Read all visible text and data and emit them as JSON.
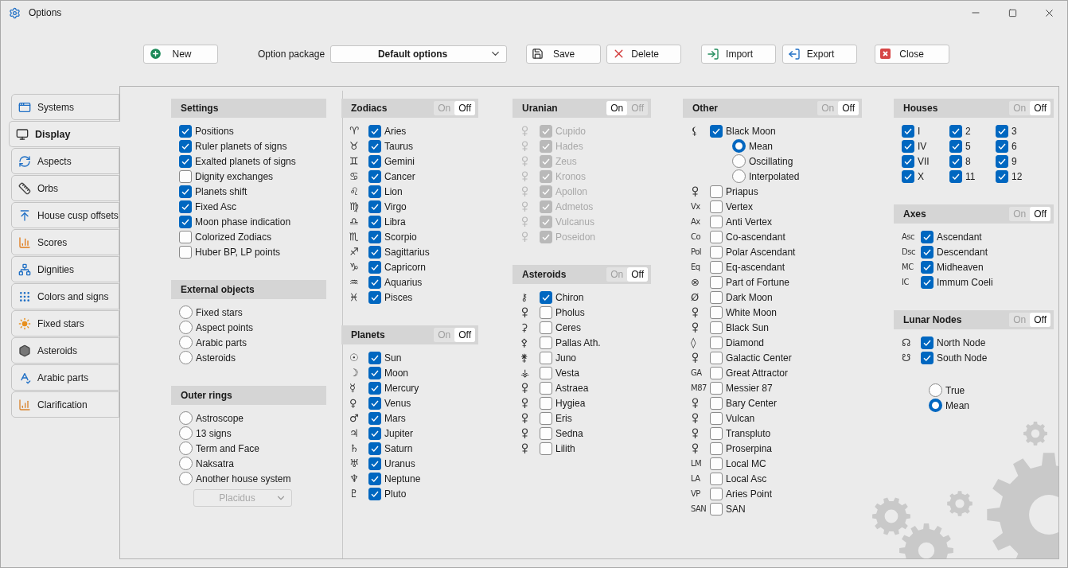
{
  "window": {
    "title": "Options"
  },
  "toolbar": [
    {
      "kind": "button",
      "label": "New"
    },
    {
      "kind": "select",
      "label": "Option package",
      "value": "Default options"
    },
    {
      "kind": "button",
      "label": "Save"
    },
    {
      "kind": "button",
      "label": "Delete"
    },
    {
      "kind": "button",
      "label": "Import"
    },
    {
      "kind": "button",
      "label": "Export"
    },
    {
      "kind": "button",
      "label": "Close"
    }
  ],
  "tabs": [
    {
      "label": "Systems",
      "selected": false
    },
    {
      "label": "Display",
      "selected": true
    },
    {
      "label": "Aspects",
      "selected": false
    },
    {
      "label": "Orbs",
      "selected": false
    },
    {
      "label": "House cusp offsets",
      "selected": false
    },
    {
      "label": "Scores",
      "selected": false
    },
    {
      "label": "Dignities",
      "selected": false
    },
    {
      "label": "Colors and signs",
      "selected": false
    },
    {
      "label": "Fixed stars",
      "selected": false
    },
    {
      "label": "Asteroids",
      "selected": false
    },
    {
      "label": "Arabic parts",
      "selected": false
    },
    {
      "label": "Clarification",
      "selected": false
    }
  ],
  "columns": [
    {
      "sections": [
        {
          "title": "Settings",
          "kind": "plain",
          "items": [
            {
              "kind": "check",
              "label": "Positions",
              "checked": true
            },
            {
              "kind": "check",
              "label": "Ruler planets of signs",
              "checked": true
            },
            {
              "kind": "check",
              "label": "Exalted planets of signs",
              "checked": true
            },
            {
              "kind": "check",
              "label": "Dignity exchanges",
              "checked": false
            },
            {
              "kind": "check",
              "label": "Planets shift",
              "checked": true
            },
            {
              "kind": "check",
              "label": "Fixed Asc",
              "checked": true
            },
            {
              "kind": "check",
              "label": "Moon phase indication",
              "checked": true
            },
            {
              "kind": "check",
              "label": "Colorized Zodiacs",
              "checked": false
            },
            {
              "kind": "check",
              "label": "Huber BP, LP points",
              "checked": false
            }
          ]
        },
        {
          "title": "External objects",
          "kind": "plain",
          "items": [
            {
              "kind": "radio",
              "label": "Fixed stars",
              "selected": false
            },
            {
              "kind": "radio",
              "label": "Aspect points",
              "selected": false
            },
            {
              "kind": "radio",
              "label": "Arabic parts",
              "selected": false
            },
            {
              "kind": "radio",
              "label": "Asteroids",
              "selected": false
            }
          ]
        },
        {
          "title": "Outer rings",
          "kind": "plain",
          "items": [
            {
              "kind": "radio",
              "label": "Astroscope",
              "selected": false
            },
            {
              "kind": "radio",
              "label": "13 signs",
              "selected": false
            },
            {
              "kind": "radio",
              "label": "Term and Face",
              "selected": false
            },
            {
              "kind": "radio",
              "label": "Naksatra",
              "selected": false
            },
            {
              "kind": "radio",
              "label": "Another house system",
              "selected": false
            },
            {
              "kind": "select",
              "value": "Placidus",
              "disabled": true
            }
          ]
        }
      ]
    },
    {
      "sections": [
        {
          "title": "Zodiacs",
          "kind": "symbols",
          "toggle": [
            {
              "label": "On",
              "selected": false
            },
            {
              "label": "Off",
              "selected": true
            }
          ],
          "items": [
            {
              "kind": "check",
              "symbol": "♈",
              "label": "Aries",
              "checked": true
            },
            {
              "kind": "check",
              "symbol": "♉",
              "label": "Taurus",
              "checked": true
            },
            {
              "kind": "check",
              "symbol": "♊",
              "label": "Gemini",
              "checked": true
            },
            {
              "kind": "check",
              "symbol": "♋",
              "label": "Cancer",
              "checked": true
            },
            {
              "kind": "check",
              "symbol": "♌",
              "label": "Lion",
              "checked": true
            },
            {
              "kind": "check",
              "symbol": "♍",
              "label": "Virgo",
              "checked": true
            },
            {
              "kind": "check",
              "symbol": "♎",
              "label": "Libra",
              "checked": true
            },
            {
              "kind": "check",
              "symbol": "♏",
              "label": "Scorpio",
              "checked": true
            },
            {
              "kind": "check",
              "symbol": "♐",
              "label": "Sagittarius",
              "checked": true
            },
            {
              "kind": "check",
              "symbol": "♑",
              "label": "Capricorn",
              "checked": true
            },
            {
              "kind": "check",
              "symbol": "♒",
              "label": "Aquarius",
              "checked": true
            },
            {
              "kind": "check",
              "symbol": "♓",
              "label": "Pisces",
              "checked": true
            }
          ]
        },
        {
          "title": "Planets",
          "kind": "symbols",
          "toggle": [
            {
              "label": "On",
              "selected": false
            },
            {
              "label": "Off",
              "selected": true
            }
          ],
          "items": [
            {
              "kind": "check",
              "symbol": "☉",
              "label": "Sun",
              "checked": true
            },
            {
              "kind": "check",
              "symbol": "☽",
              "label": "Moon",
              "checked": true
            },
            {
              "kind": "check",
              "symbol": "☿",
              "label": "Mercury",
              "checked": true
            },
            {
              "kind": "check",
              "symbol": "♀",
              "label": "Venus",
              "checked": true
            },
            {
              "kind": "check",
              "symbol": "♂",
              "label": "Mars",
              "checked": true
            },
            {
              "kind": "check",
              "symbol": "♃",
              "label": "Jupiter",
              "checked": true
            },
            {
              "kind": "check",
              "symbol": "♄",
              "label": "Saturn",
              "checked": true
            },
            {
              "kind": "check",
              "symbol": "♅",
              "label": "Uranus",
              "checked": true
            },
            {
              "kind": "check",
              "symbol": "♆",
              "label": "Neptune",
              "checked": true
            },
            {
              "kind": "check",
              "symbol": "♇",
              "label": "Pluto",
              "checked": true
            }
          ]
        }
      ]
    },
    {
      "sections": [
        {
          "title": "Uranian",
          "kind": "symbols",
          "disabled": true,
          "toggle": [
            {
              "label": "On",
              "selected": true
            },
            {
              "label": "Off",
              "selected": false
            }
          ],
          "items": [
            {
              "kind": "check",
              "label": "Cupido",
              "checked": true
            },
            {
              "kind": "check",
              "label": "Hades",
              "checked": true
            },
            {
              "kind": "check",
              "label": "Zeus",
              "checked": true
            },
            {
              "kind": "check",
              "label": "Kronos",
              "checked": true
            },
            {
              "kind": "check",
              "label": "Apollon",
              "checked": true
            },
            {
              "kind": "check",
              "label": "Admetos",
              "checked": true
            },
            {
              "kind": "check",
              "label": "Vulcanus",
              "checked": true
            },
            {
              "kind": "check",
              "label": "Poseidon",
              "checked": true
            }
          ]
        },
        {
          "title": "Asteroids",
          "kind": "symbols",
          "toggle": [
            {
              "label": "On",
              "selected": false
            },
            {
              "label": "Off",
              "selected": true
            }
          ],
          "items": [
            {
              "kind": "check",
              "symbol": "⚷",
              "label": "Chiron",
              "checked": true
            },
            {
              "kind": "check",
              "label": "Pholus",
              "checked": false
            },
            {
              "kind": "check",
              "symbol": "⚳",
              "label": "Ceres",
              "checked": false
            },
            {
              "kind": "check",
              "symbol": "⚴",
              "label": "Pallas Ath.",
              "checked": false
            },
            {
              "kind": "check",
              "symbol": "⚵",
              "label": "Juno",
              "checked": false
            },
            {
              "kind": "check",
              "symbol": "⚶",
              "label": "Vesta",
              "checked": false
            },
            {
              "kind": "check",
              "label": "Astraea",
              "checked": false
            },
            {
              "kind": "check",
              "label": "Hygiea",
              "checked": false
            },
            {
              "kind": "check",
              "label": "Eris",
              "checked": false
            },
            {
              "kind": "check",
              "label": "Sedna",
              "checked": false
            },
            {
              "kind": "check",
              "label": "Lilith",
              "checked": false
            }
          ]
        }
      ]
    },
    {
      "sections": [
        {
          "title": "Other",
          "kind": "symbols",
          "toggle": [
            {
              "label": "On",
              "selected": false
            },
            {
              "label": "Off",
              "selected": true
            }
          ],
          "items": [
            {
              "kind": "check",
              "symbol": "⚸",
              "label": "Black Moon",
              "checked": true,
              "options": [
                {
                  "label": "Mean",
                  "selected": true
                },
                {
                  "label": "Oscillating",
                  "selected": false
                },
                {
                  "label": "Interpolated",
                  "selected": false
                }
              ]
            },
            {
              "kind": "check",
              "label": "Priapus",
              "checked": false
            },
            {
              "kind": "check",
              "symbol": "Vx",
              "label": "Vertex",
              "checked": false
            },
            {
              "kind": "check",
              "symbol": "Ax",
              "label": "Anti Vertex",
              "checked": false
            },
            {
              "kind": "check",
              "symbol": "Co",
              "label": "Co-ascendant",
              "checked": false
            },
            {
              "kind": "check",
              "symbol": "Pol",
              "label": "Polar Ascendant",
              "checked": false
            },
            {
              "kind": "check",
              "symbol": "Eq",
              "label": "Eq-ascendant",
              "checked": false
            },
            {
              "kind": "check",
              "symbol": "⊗",
              "label": "Part of Fortune",
              "checked": false
            },
            {
              "kind": "check",
              "symbol": "Ø",
              "label": "Dark Moon",
              "checked": false
            },
            {
              "kind": "check",
              "label": "White Moon",
              "checked": false
            },
            {
              "kind": "check",
              "label": "Black Sun",
              "checked": false
            },
            {
              "kind": "check",
              "symbol": "◊",
              "label": "Diamond",
              "checked": false
            },
            {
              "kind": "check",
              "label": "Galactic Center",
              "checked": false
            },
            {
              "kind": "check",
              "symbol": "GA",
              "label": "Great Attractor",
              "checked": false
            },
            {
              "kind": "check",
              "symbol": "M87",
              "label": "Messier 87",
              "checked": false
            },
            {
              "kind": "check",
              "label": "Bary Center",
              "checked": false
            },
            {
              "kind": "check",
              "label": "Vulcan",
              "checked": false
            },
            {
              "kind": "check",
              "label": "Transpluto",
              "checked": false
            },
            {
              "kind": "check",
              "label": "Proserpina",
              "checked": false
            },
            {
              "kind": "check",
              "symbol": "LM",
              "label": "Local MC",
              "checked": false
            },
            {
              "kind": "check",
              "symbol": "LA",
              "label": "Local Asc",
              "checked": false
            },
            {
              "kind": "check",
              "symbol": "VP",
              "label": "Aries Point",
              "checked": false
            },
            {
              "kind": "check",
              "symbol": "SAN",
              "label": "SAN",
              "checked": false
            }
          ]
        }
      ]
    },
    {
      "sections": [
        {
          "title": "Houses",
          "kind": "grid",
          "toggle": [
            {
              "label": "On",
              "selected": false
            },
            {
              "label": "Off",
              "selected": true
            }
          ],
          "items": [
            {
              "kind": "check",
              "label": "I",
              "checked": true
            },
            {
              "kind": "check",
              "label": "2",
              "checked": true
            },
            {
              "kind": "check",
              "label": "3",
              "checked": true
            },
            {
              "kind": "check",
              "label": "IV",
              "checked": true
            },
            {
              "kind": "check",
              "label": "5",
              "checked": true
            },
            {
              "kind": "check",
              "label": "6",
              "checked": true
            },
            {
              "kind": "check",
              "label": "VII",
              "checked": true
            },
            {
              "kind": "check",
              "label": "8",
              "checked": true
            },
            {
              "kind": "check",
              "label": "9",
              "checked": true
            },
            {
              "kind": "check",
              "label": "X",
              "checked": true
            },
            {
              "kind": "check",
              "label": "11",
              "checked": true
            },
            {
              "kind": "check",
              "label": "12",
              "checked": true
            }
          ]
        },
        {
          "title": "Axes",
          "kind": "symbols",
          "toggle": [
            {
              "label": "On",
              "selected": false
            },
            {
              "label": "Off",
              "selected": true
            }
          ],
          "items": [
            {
              "kind": "check",
              "symbol": "Asc",
              "label": "Ascendant",
              "checked": true
            },
            {
              "kind": "check",
              "symbol": "Dsc",
              "label": "Descendant",
              "checked": true
            },
            {
              "kind": "check",
              "symbol": "MC",
              "label": "Midheaven",
              "checked": true
            },
            {
              "kind": "check",
              "symbol": "IC",
              "label": "Immum Coeli",
              "checked": true
            }
          ]
        },
        {
          "title": "Lunar Nodes",
          "kind": "symbols",
          "toggle": [
            {
              "label": "On",
              "selected": false
            },
            {
              "label": "Off",
              "selected": true
            }
          ],
          "items": [
            {
              "kind": "check",
              "symbol": "☊",
              "label": "North Node",
              "checked": true
            },
            {
              "kind": "check",
              "symbol": "☋",
              "label": "South Node",
              "checked": true
            },
            {
              "kind": "radio",
              "label": "True",
              "selected": false
            },
            {
              "kind": "radio",
              "label": "Mean",
              "selected": true
            }
          ]
        }
      ]
    }
  ]
}
